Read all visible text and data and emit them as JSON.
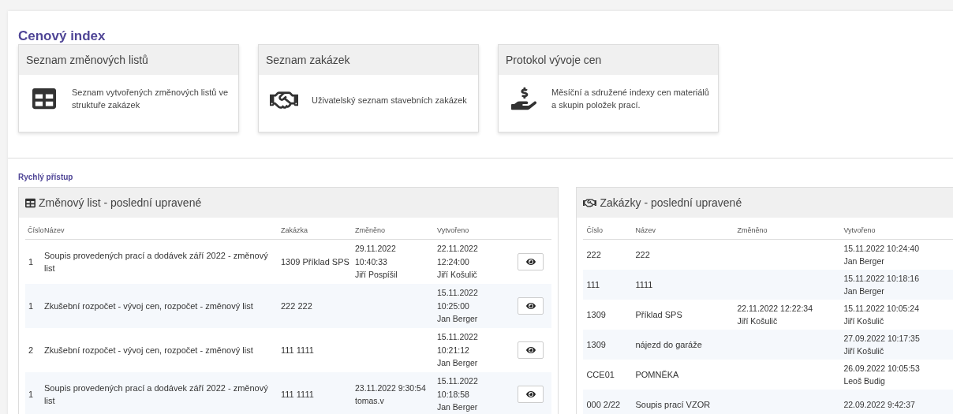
{
  "page_title": "Cenový index",
  "cards": [
    {
      "title": "Seznam změnových listů",
      "description": "Seznam vytvořených změnových listů ve struktuře zakázek"
    },
    {
      "title": "Seznam zakázek",
      "description": "Uživatelský seznam stavebních zakázek"
    },
    {
      "title": "Protokol vývoje cen",
      "description": "Měsíční a sdružené indexy cen materiálů a skupin položek prací."
    }
  ],
  "quick_access_label": "Rychlý přístup",
  "change_sheets": {
    "title": "Změnový list - poslední upravené",
    "columns": [
      "Číslo",
      "Název",
      "Zakázka",
      "Změněno",
      "Vytvořeno"
    ],
    "rows": [
      {
        "number": "1",
        "name": "Soupis provedených prací a dodávek září 2022 - změnový list",
        "order": "1309 Příklad SPS",
        "changed": [
          "29.11.2022",
          "10:40:33",
          "Jiří Pospíšil"
        ],
        "created": [
          "22.11.2022",
          "12:24:00",
          "Jiří Košulič"
        ]
      },
      {
        "number": "1",
        "name": "Zkušební rozpočet - vývoj cen, rozpočet - změnový list",
        "order": "222 222",
        "changed": [],
        "created": [
          "15.11.2022",
          "10:25:00",
          "Jan Berger"
        ]
      },
      {
        "number": "2",
        "name": "Zkušební rozpočet - vývoj cen, rozpočet - změnový list",
        "order": "111 1111",
        "changed": [],
        "created": [
          "15.11.2022",
          "10:21:12",
          "Jan Berger"
        ]
      },
      {
        "number": "1",
        "name": "Soupis provedených prací a dodávek září 2022 - změnový list",
        "order": "111 1111",
        "changed": [
          "23.11.2022 9:30:54",
          "tomas.v"
        ],
        "created": [
          "15.11.2022",
          "10:18:58",
          "Jan Berger"
        ]
      }
    ]
  },
  "orders": {
    "title": "Zakázky - poslední upravené",
    "columns": [
      "Číslo",
      "Název",
      "Změněno",
      "Vytvořeno"
    ],
    "rows": [
      {
        "number": "222",
        "name": "222",
        "changed": [],
        "created": [
          "15.11.2022 10:24:40",
          "Jan Berger"
        ]
      },
      {
        "number": "111",
        "name": "1111",
        "changed": [],
        "created": [
          "15.11.2022 10:18:16",
          "Jan Berger"
        ]
      },
      {
        "number": "1309",
        "name": "Příklad SPS",
        "changed": [
          "22.11.2022 12:22:34",
          "Jiří Košulič"
        ],
        "created": [
          "15.11.2022 10:05:24",
          "Jiří Košulič"
        ]
      },
      {
        "number": "1309",
        "name": "nájezd do garáže",
        "changed": [],
        "created": [
          "27.09.2022 10:17:35",
          "Jiří Košulič"
        ]
      },
      {
        "number": "CCE01",
        "name": "POMNĚKA",
        "changed": [],
        "created": [
          "26.09.2022 10:05:53",
          "Leoš Budig"
        ]
      },
      {
        "number": "000 2/22",
        "name": "Soupis prací VZOR",
        "changed": [],
        "created": [
          "22.09.2022 9:42:37"
        ]
      }
    ]
  }
}
